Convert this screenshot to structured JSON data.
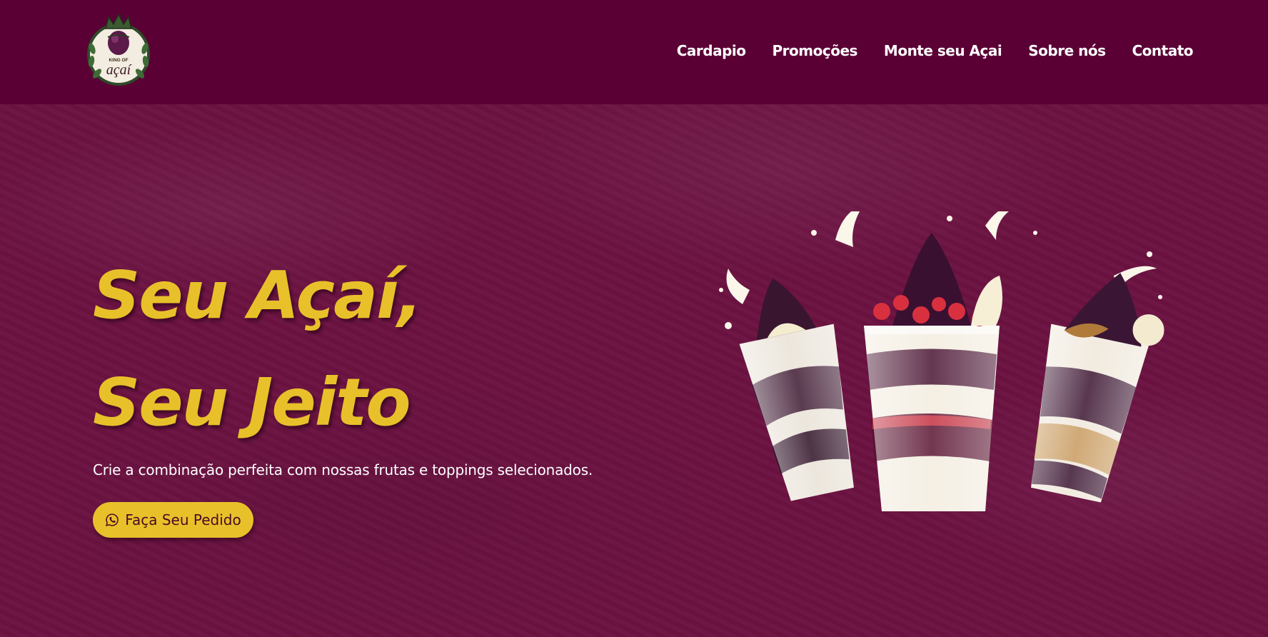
{
  "brand": {
    "logo_top_text": "KING OF",
    "logo_main_text": "açaí",
    "icon": "crown-acai-logo"
  },
  "nav": {
    "items": [
      {
        "label": "Cardapio"
      },
      {
        "label": "Promoções"
      },
      {
        "label": "Monte seu Açai"
      },
      {
        "label": "Sobre nós"
      },
      {
        "label": "Contato"
      }
    ]
  },
  "hero": {
    "title_line1": "Seu Açaí,",
    "title_line2": "Seu Jeito",
    "subtitle": "Crie a combinação perfeita com nossas frutas e toppings selecionados.",
    "cta_label": "Faça Seu Pedido",
    "cta_icon": "whatsapp-icon",
    "image": "three-acai-cups-splash"
  },
  "colors": {
    "nav_bg": "#5a0035",
    "hero_bg": "#6b1241",
    "accent_yellow": "#e8c12a",
    "text_white": "#ffffff"
  }
}
